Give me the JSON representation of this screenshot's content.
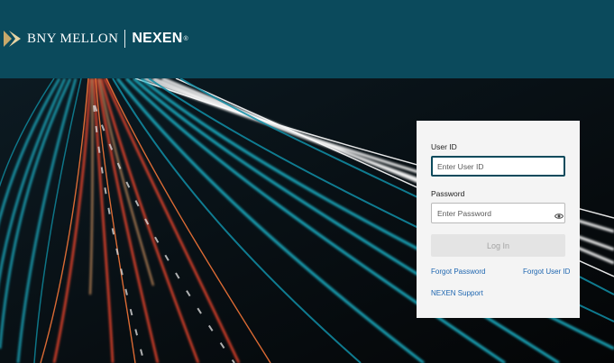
{
  "header": {
    "brand_name": "BNY MELLON",
    "product_name": "NEXEN",
    "registered_mark": "®",
    "background_color": "#0b4a5c",
    "logo_icon": "bny-mellon-arrow-logo"
  },
  "hero": {
    "image": "highway-light-trails-night",
    "colors": {
      "red": "#ff4a2e",
      "teal": "#1db4c9",
      "white": "#f2f2f2"
    }
  },
  "login": {
    "user_id_label": "User ID",
    "user_id_placeholder": "Enter User ID",
    "password_label": "Password",
    "password_placeholder": "Enter Password",
    "password_toggle_icon": "eye-icon",
    "login_button_label": "Log In",
    "forgot_password_link": "Forgot Password",
    "forgot_user_id_link": "Forgot User ID",
    "support_link": "NEXEN Support",
    "link_color": "#1e66b0"
  }
}
